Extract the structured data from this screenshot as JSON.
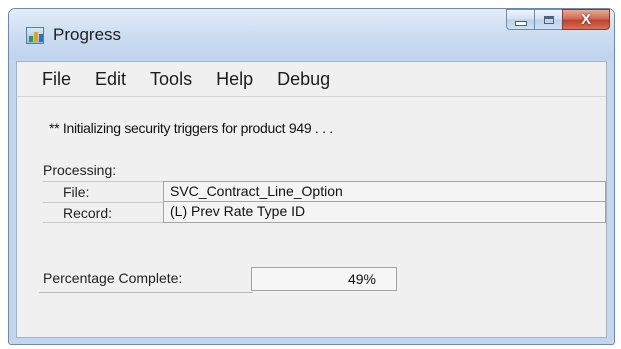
{
  "window": {
    "title": "Progress",
    "icon": "progress-chart-icon",
    "buttons": {
      "minimize": "minimize-icon",
      "maximize": "maximize-icon",
      "close": "close-icon"
    },
    "close_glyph": "X"
  },
  "menu": {
    "items": [
      {
        "label": "File"
      },
      {
        "label": "Edit"
      },
      {
        "label": "Tools"
      },
      {
        "label": "Help"
      },
      {
        "label": "Debug"
      }
    ]
  },
  "status": {
    "message": "** Initializing security triggers for product 949 . . ."
  },
  "processing": {
    "label": "Processing:",
    "file_label": "File:",
    "file_value": "SVC_Contract_Line_Option",
    "record_label": "Record:",
    "record_value": "(L) Prev Rate Type ID"
  },
  "progress": {
    "label": "Percentage Complete:",
    "value_text": "49%",
    "value_fraction": 0.49
  },
  "colors": {
    "title_bar": "#cfdff2",
    "close_button": "#c0432b",
    "client_bg": "#f0f0f0"
  }
}
